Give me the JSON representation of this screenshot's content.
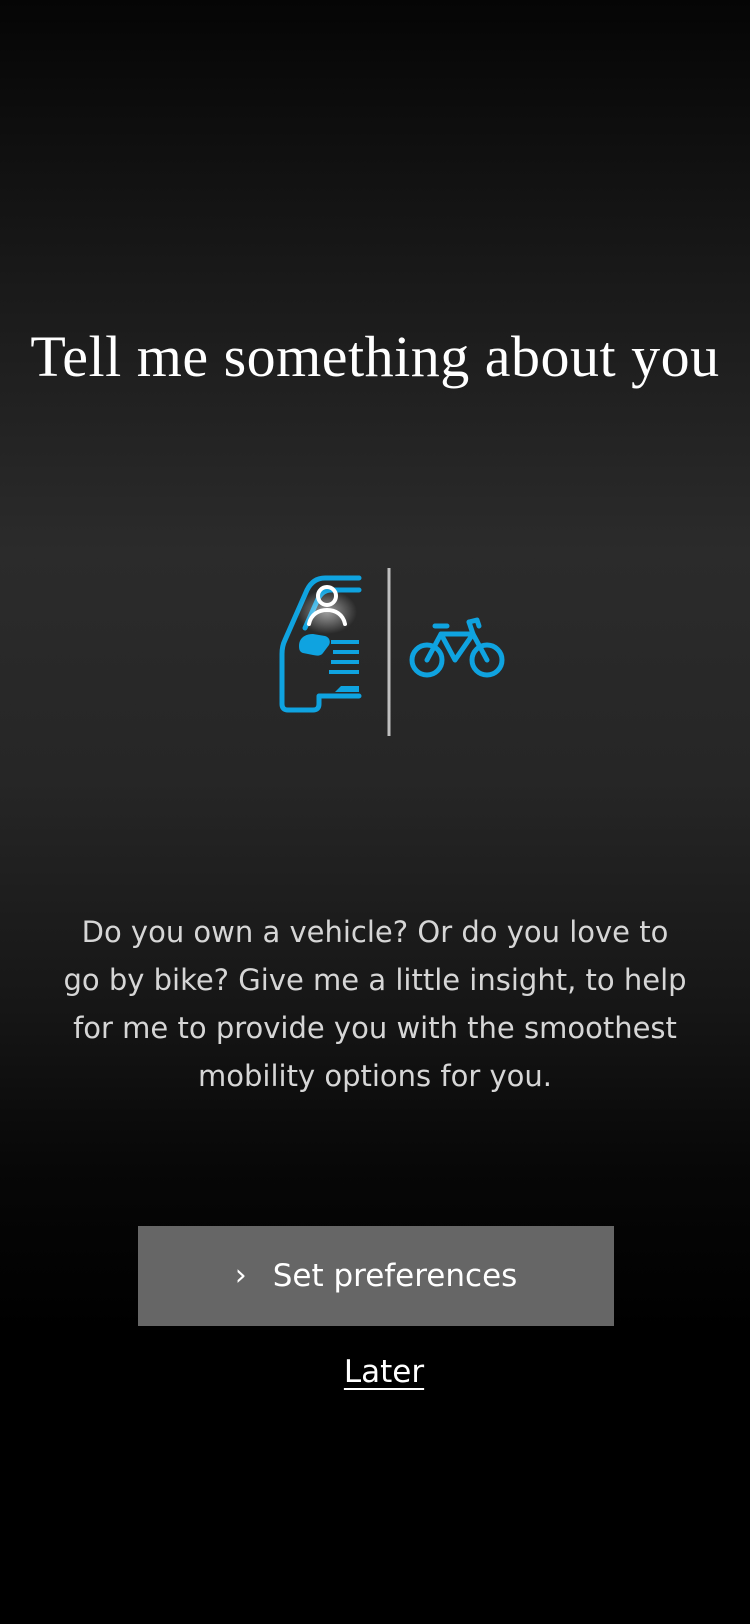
{
  "onboarding": {
    "title": "Tell me something about you",
    "description": "Do you own a vehicle? Or do you love to go by bike? Give me a little insight, to help for me to provide you with the smoothest mobility options for you.",
    "primary_button": {
      "label": "Set preferences",
      "icon": "chevron-right-icon"
    },
    "secondary_link": {
      "label": "Later"
    },
    "illustration": {
      "icons": [
        "car-with-driver-icon",
        "bicycle-icon"
      ]
    }
  },
  "colors": {
    "accent": "#0fa3e0",
    "button_background": "#666666",
    "text_primary": "#ffffff",
    "text_secondary": "#d6d6d6"
  }
}
